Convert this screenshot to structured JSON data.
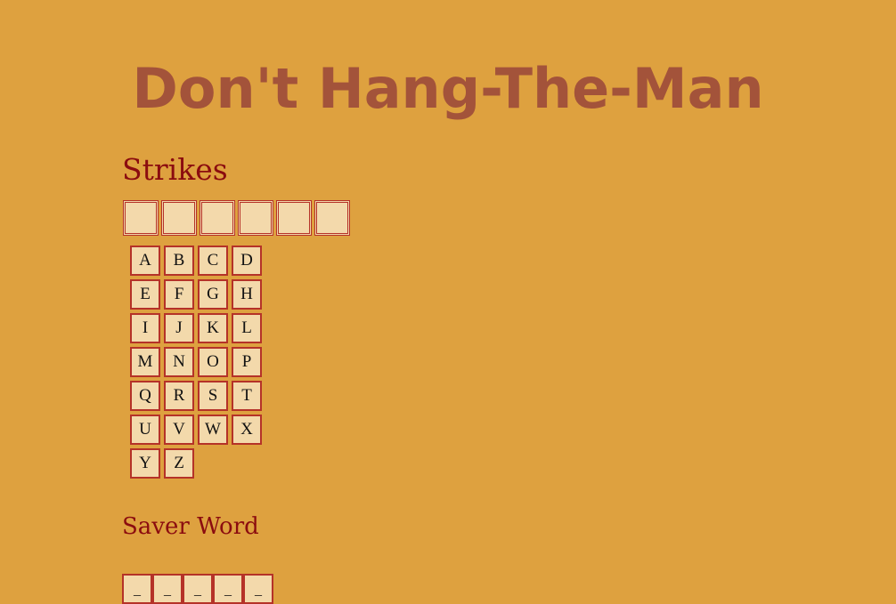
{
  "title": "Don't Hang-The-Man",
  "strikes": {
    "heading": "Strikes",
    "total": 6,
    "used": 0
  },
  "letters": [
    "A",
    "B",
    "C",
    "D",
    "E",
    "F",
    "G",
    "H",
    "I",
    "J",
    "K",
    "L",
    "M",
    "N",
    "O",
    "P",
    "Q",
    "R",
    "S",
    "T",
    "U",
    "V",
    "W",
    "X",
    "Y",
    "Z"
  ],
  "saver_word": {
    "heading": "Saver Word",
    "slots": [
      "_",
      "_",
      "_",
      "_",
      "_"
    ]
  },
  "colors": {
    "background": "#dea13f",
    "title": "#a3533a",
    "heading": "#8b0c0f",
    "tile_fill": "#f3d9ab",
    "tile_border": "#b53228"
  }
}
